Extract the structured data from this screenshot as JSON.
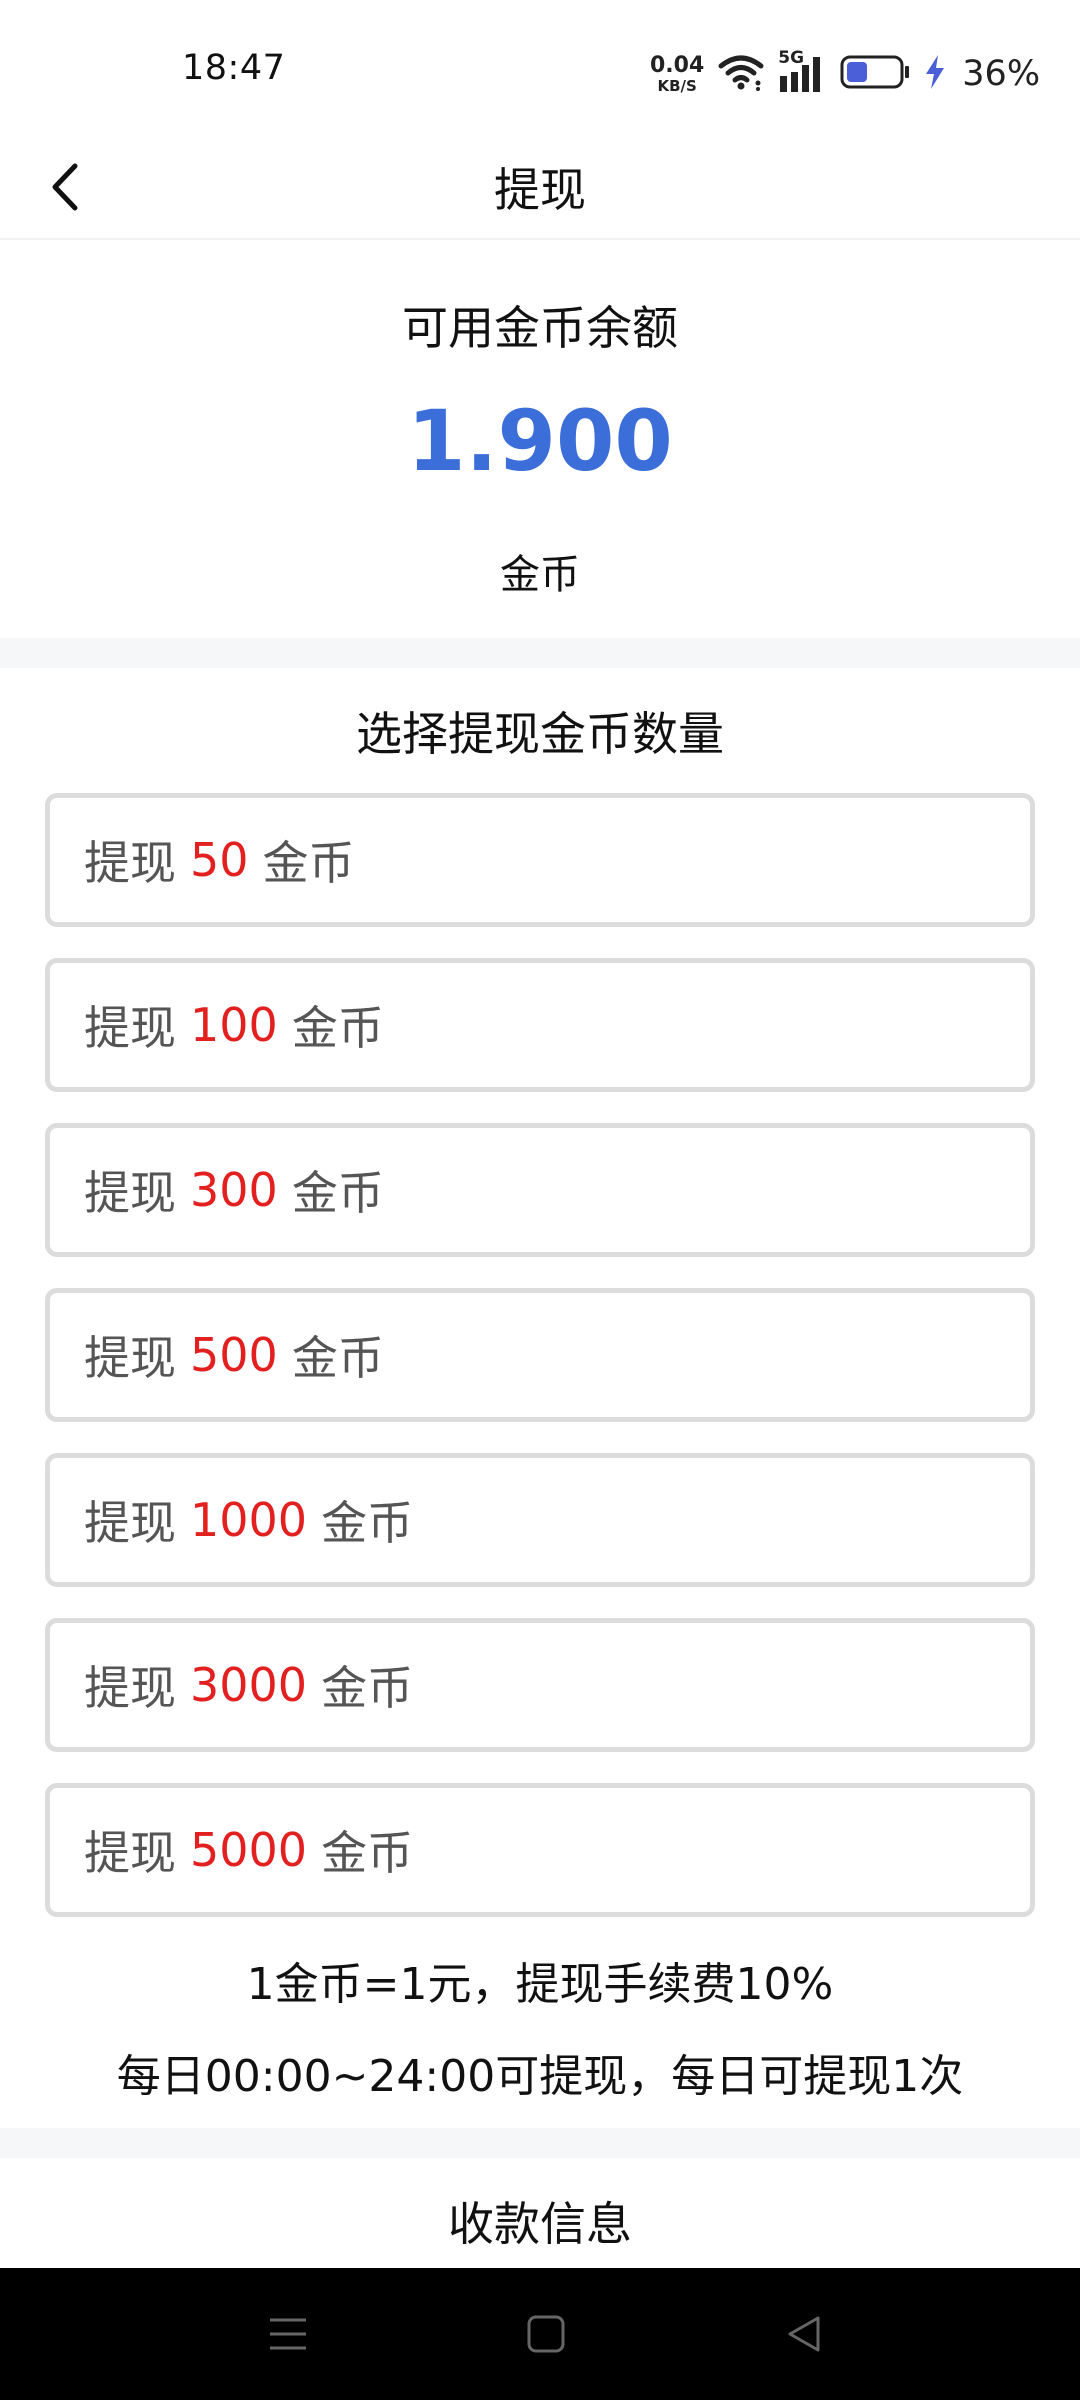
{
  "status_bar": {
    "time": "18:47",
    "net_speed_value": "0.04",
    "net_speed_unit": "KB/S",
    "network_label": "5G",
    "battery_percent": "36%"
  },
  "header": {
    "title": "提现"
  },
  "balance": {
    "label": "可用金币余额",
    "value": "1.900",
    "unit": "金币"
  },
  "withdraw": {
    "title": "选择提现金币数量",
    "options": [
      {
        "prefix": "提现",
        "amount": "50",
        "suffix": "金币"
      },
      {
        "prefix": "提现",
        "amount": "100",
        "suffix": "金币"
      },
      {
        "prefix": "提现",
        "amount": "300",
        "suffix": "金币"
      },
      {
        "prefix": "提现",
        "amount": "500",
        "suffix": "金币"
      },
      {
        "prefix": "提现",
        "amount": "1000",
        "suffix": "金币"
      },
      {
        "prefix": "提现",
        "amount": "3000",
        "suffix": "金币"
      },
      {
        "prefix": "提现",
        "amount": "5000",
        "suffix": "金币"
      }
    ],
    "note_rate": "1金币=1元，提现手续费10%",
    "note_time": "每日00:00~24:00可提现，每日可提现1次"
  },
  "payee": {
    "title": "收款信息"
  },
  "colors": {
    "accent": "#3b6ed8",
    "amount": "#e32020",
    "border": "#dcdcdc"
  },
  "icons": {
    "back": "chevron-left-icon",
    "wifi": "wifi-icon",
    "signal": "signal-icon",
    "battery": "battery-icon",
    "charging": "charging-bolt-icon",
    "nav_menu": "menu-icon",
    "nav_home": "home-square-icon",
    "nav_back": "back-triangle-icon"
  }
}
